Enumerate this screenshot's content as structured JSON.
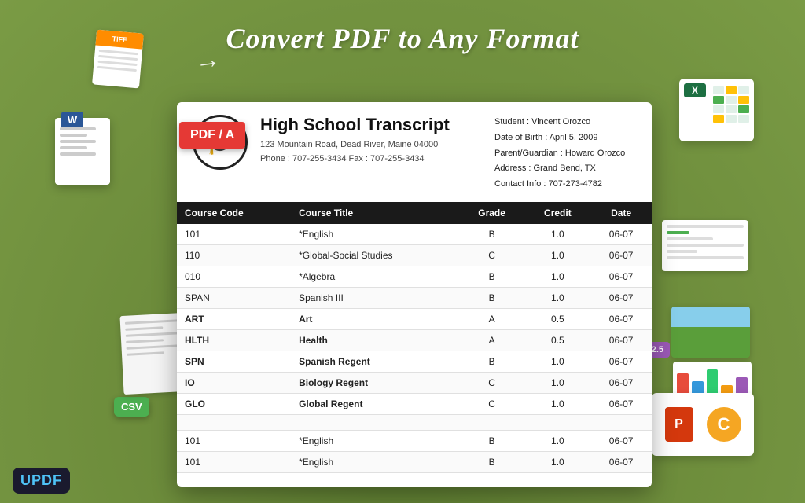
{
  "page": {
    "background_color": "#6b8a3a",
    "title": "Convert PDF to Any Format"
  },
  "updf": {
    "logo": "UPDF"
  },
  "pdf_badge": {
    "label": "PDF / A"
  },
  "transcript": {
    "school_name": "High School Transcript",
    "address": "123 Mountain Road, Dead River, Maine 04000",
    "phone": "Phone : 707-255-3434   Fax : 707-255-3434",
    "student_name": "Student : Vincent Orozco",
    "dob": "Date of Birth : April 5, 2009",
    "parent": "Parent/Guardian : Howard Orozco",
    "address_student": "Address : Grand Bend, TX",
    "contact": "Contact Info : 707-273-4782"
  },
  "table": {
    "headers": [
      "Course Code",
      "Course Title",
      "Grade",
      "Credit",
      "Date"
    ],
    "rows": [
      {
        "code": "101",
        "title": "*English",
        "grade": "B",
        "credit": "1.0",
        "date": "06-07"
      },
      {
        "code": "110",
        "title": "*Global-Social Studies",
        "grade": "C",
        "credit": "1.0",
        "date": "06-07"
      },
      {
        "code": "010",
        "title": "*Algebra",
        "grade": "B",
        "credit": "1.0",
        "date": "06-07"
      },
      {
        "code": "SPAN",
        "title": "Spanish III",
        "grade": "B",
        "credit": "1.0",
        "date": "06-07"
      },
      {
        "code": "ART",
        "title": "Art",
        "grade": "A",
        "credit": "0.5",
        "date": "06-07"
      },
      {
        "code": "HLTH",
        "title": "Health",
        "grade": "A",
        "credit": "0.5",
        "date": "06-07"
      },
      {
        "code": "SPN",
        "title": "Spanish Regent",
        "grade": "B",
        "credit": "1.0",
        "date": "06-07"
      },
      {
        "code": "IO",
        "title": "Biology Regent",
        "grade": "C",
        "credit": "1.0",
        "date": "06-07"
      },
      {
        "code": "GLO",
        "title": "Global Regent",
        "grade": "C",
        "credit": "1.0",
        "date": "06-07"
      },
      {
        "code": "",
        "title": "",
        "grade": "",
        "credit": "",
        "date": ""
      },
      {
        "code": "101",
        "title": "*English",
        "grade": "B",
        "credit": "1.0",
        "date": "06-07"
      },
      {
        "code": "101",
        "title": "*English",
        "grade": "B",
        "credit": "1.0",
        "date": "06-07"
      }
    ]
  },
  "decorations": {
    "word_label": "W",
    "excel_label": "X",
    "ppt_label": "P",
    "c_label": "C",
    "csv_label": "CSV",
    "tiff_label": "TIFF"
  }
}
